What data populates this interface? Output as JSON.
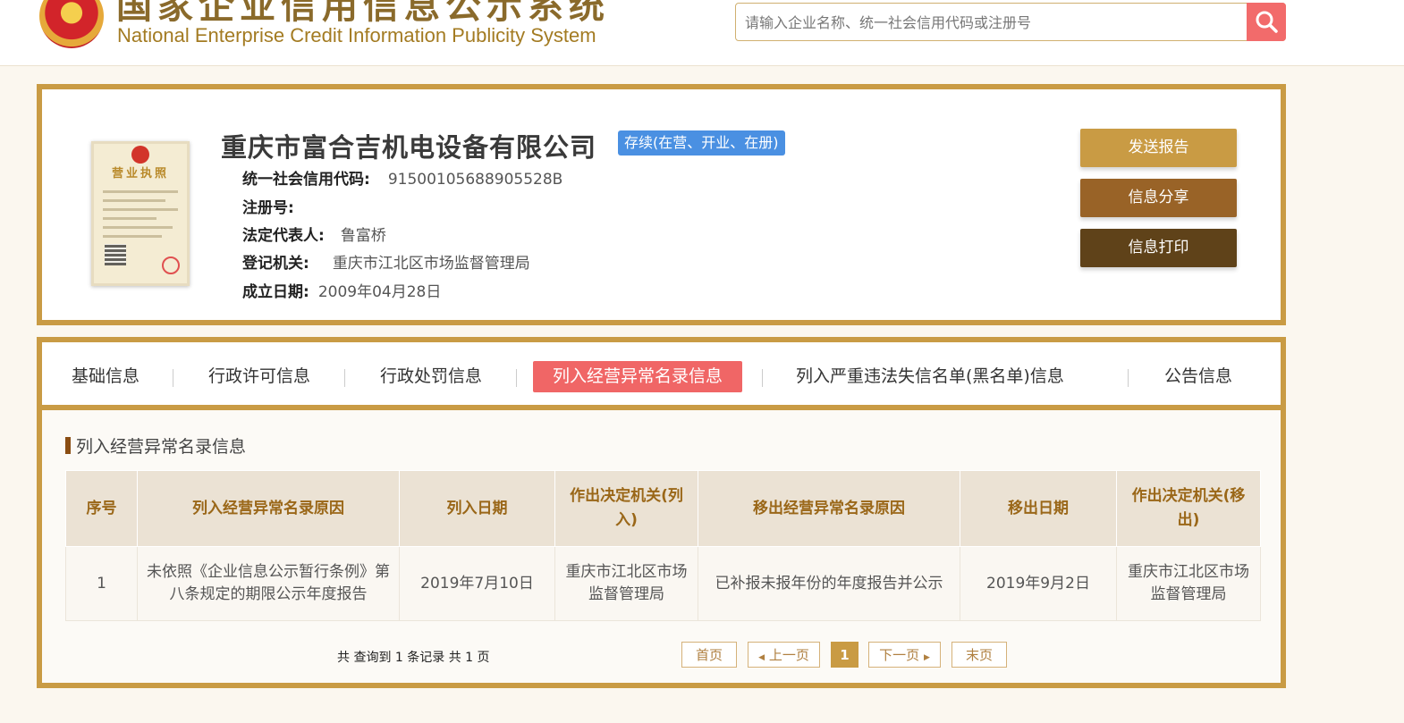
{
  "header": {
    "logo_cn": "国家企业信用信息公示系统",
    "logo_en": "National Enterprise Credit Information Publicity System",
    "search_placeholder": "请输入企业名称、统一社会信用代码或注册号"
  },
  "company": {
    "name": "重庆市富合吉机电设备有限公司",
    "status": "存续(在营、开业、在册)",
    "license_title": "营业执照",
    "fields": [
      {
        "label": "统一社会信用代码:",
        "value": "91500105688905528B"
      },
      {
        "label": "注册号:",
        "value": ""
      },
      {
        "label": "法定代表人:",
        "value": "鲁富桥"
      },
      {
        "label": "登记机关:",
        "value": "重庆市江北区市场监督管理局"
      },
      {
        "label": "成立日期:",
        "value": "2009年04月28日"
      }
    ]
  },
  "actions": {
    "send_report": "发送报告",
    "share": "信息分享",
    "print": "信息打印"
  },
  "tabs": [
    {
      "label": "基础信息",
      "active": false
    },
    {
      "label": "行政许可信息",
      "active": false
    },
    {
      "label": "行政处罚信息",
      "active": false
    },
    {
      "label": "列入经营异常名录信息",
      "active": true
    },
    {
      "label": "列入严重违法失信名单(黑名单)信息",
      "active": false
    },
    {
      "label": "公告信息",
      "active": false
    }
  ],
  "section": {
    "title": "列入经营异常名录信息",
    "table": {
      "headers": [
        "序号",
        "列入经营异常名录原因",
        "列入日期",
        "作出决定机关(列入)",
        "移出经营异常名录原因",
        "移出日期",
        "作出决定机关(移出)"
      ],
      "rows": [
        [
          "1",
          "未依照《企业信息公示暂行条例》第八条规定的期限公示年度报告",
          "2019年7月10日",
          "重庆市江北区市场监督管理局",
          "已补报未报年份的年度报告并公示",
          "2019年9月2日",
          "重庆市江北区市场监督管理局"
        ]
      ]
    },
    "record_count": "共 查询到 1 条记录 共 1 页",
    "pagination": {
      "first": "首页",
      "prev": "上一页",
      "current": "1",
      "next": "下一页",
      "last": "末页"
    }
  },
  "colors": {
    "gold_border": "#c99b44",
    "search_button": "#f26b6b",
    "active_tab": "#f06666",
    "status_badge": "#4a90e2"
  }
}
